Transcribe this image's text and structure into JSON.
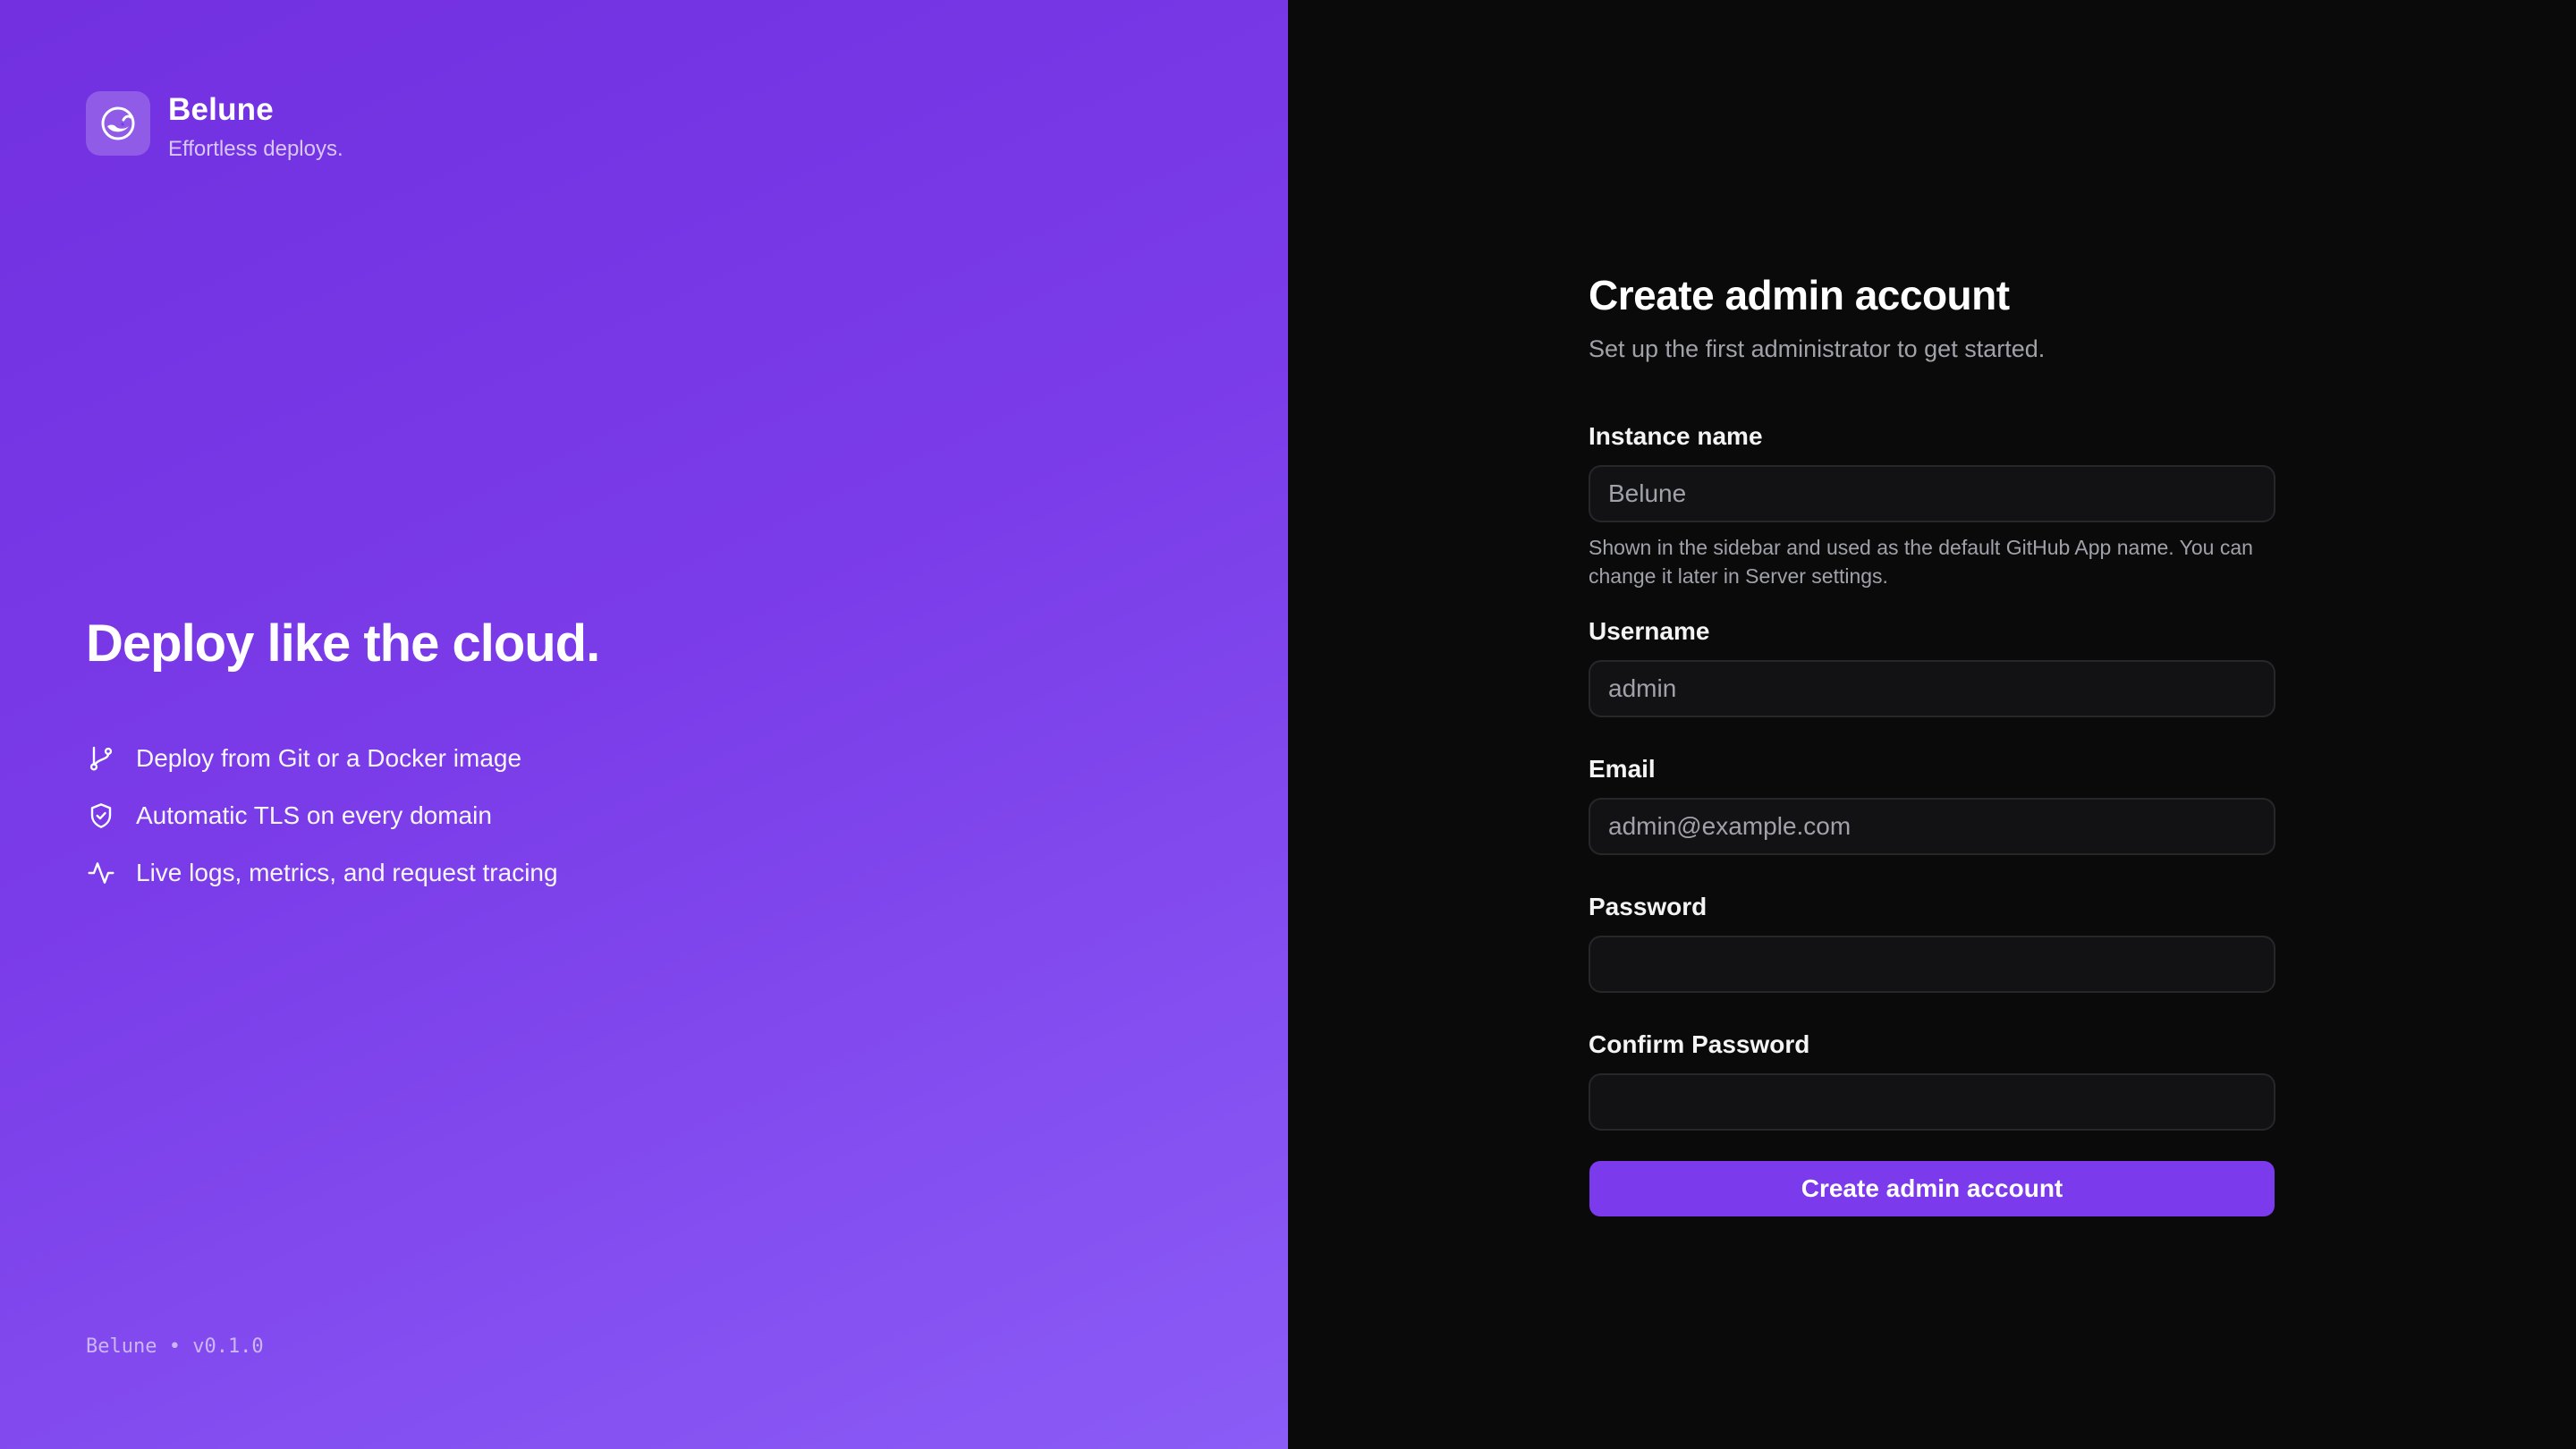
{
  "brand": {
    "name": "Belune",
    "tagline": "Effortless deploys.",
    "logo_icon": "whale-moon-icon"
  },
  "hero": {
    "title": "Deploy like the cloud.",
    "features": [
      {
        "icon": "git-branch-icon",
        "label": "Deploy from Git or a Docker image"
      },
      {
        "icon": "shield-check-icon",
        "label": "Automatic TLS on every domain"
      },
      {
        "icon": "activity-pulse-icon",
        "label": "Live logs, metrics, and request tracing"
      }
    ]
  },
  "footer": {
    "version_text": "Belune • v0.1.0"
  },
  "form": {
    "title": "Create admin account",
    "subtitle": "Set up the first administrator to get started.",
    "fields": {
      "instance": {
        "label": "Instance name",
        "placeholder": "Belune",
        "hint": "Shown in the sidebar and used as the default GitHub App name. You can change it later in Server settings."
      },
      "username": {
        "label": "Username",
        "placeholder": "admin"
      },
      "email": {
        "label": "Email",
        "placeholder": "admin@example.com"
      },
      "password": {
        "label": "Password",
        "placeholder": ""
      },
      "confirm": {
        "label": "Confirm Password",
        "placeholder": ""
      }
    },
    "submit_label": "Create admin account"
  },
  "colors": {
    "accent": "#7c3aed",
    "left_gradient_start": "#7230e0",
    "left_gradient_end": "#8b5cf6",
    "right_background": "#0a0a0b",
    "input_background": "#121214",
    "input_border": "#27272a"
  }
}
